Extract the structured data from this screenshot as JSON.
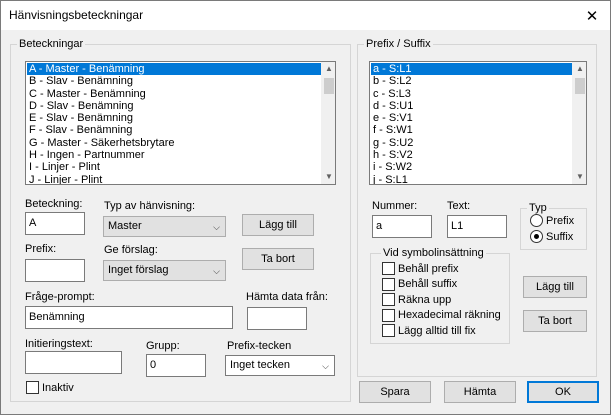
{
  "window": {
    "title": "Hänvisningsbeteckningar"
  },
  "left_group": {
    "label": "Beteckningar",
    "list_items": [
      "A - Master - Benämning",
      "B - Slav - Benämning",
      "C - Master - Benämning",
      "D - Slav - Benämning",
      "E - Slav - Benämning",
      "F - Slav - Benämning",
      "G - Master - Säkerhetsbrytare",
      "H - Ingen - Partnummer",
      "I - Linjer - Plint",
      "J - Linjer - Plint"
    ],
    "selected_index": 0,
    "beteckning": {
      "label": "Beteckning:",
      "value": "A"
    },
    "typ": {
      "label": "Typ av hänvisning:",
      "value": "Master"
    },
    "add_button": "Lägg till",
    "prefix": {
      "label": "Prefix:",
      "value": ""
    },
    "ge_forslag": {
      "label": "Ge förslag:",
      "value": "Inget förslag"
    },
    "remove_button": "Ta bort",
    "prompt": {
      "label": "Fråge-prompt:",
      "value": "Benämning"
    },
    "hamta_data": {
      "label": "Hämta data från:",
      "value": ""
    },
    "init_text": {
      "label": "Initieringstext:",
      "value": ""
    },
    "grupp": {
      "label": "Grupp:",
      "value": "0"
    },
    "prefix_tecken": {
      "label": "Prefix-tecken",
      "value": "Inget tecken"
    },
    "inaktiv_label": "Inaktiv"
  },
  "right_group": {
    "label": "Prefix / Suffix",
    "list_items": [
      "a - S:L1",
      "b - S:L2",
      "c - S:L3",
      "d - S:U1",
      "e - S:V1",
      "f - S:W1",
      "g - S:U2",
      "h - S:V2",
      "i - S:W2",
      "j - S:L1"
    ],
    "selected_index": 0,
    "nummer": {
      "label": "Nummer:",
      "value": "a"
    },
    "text": {
      "label": "Text:",
      "value": "L1"
    },
    "typ_group": {
      "label": "Typ",
      "prefix": "Prefix",
      "suffix": "Suffix",
      "selected": "Suffix"
    },
    "vid_group": {
      "label": "Vid symbolinsättning",
      "options": [
        "Behåll prefix",
        "Behåll suffix",
        "Räkna upp",
        "Hexadecimal räkning",
        "Lägg alltid till fix"
      ]
    },
    "add_button": "Lägg till",
    "remove_button": "Ta bort"
  },
  "footer": {
    "save": "Spara",
    "fetch": "Hämta",
    "ok": "OK"
  }
}
